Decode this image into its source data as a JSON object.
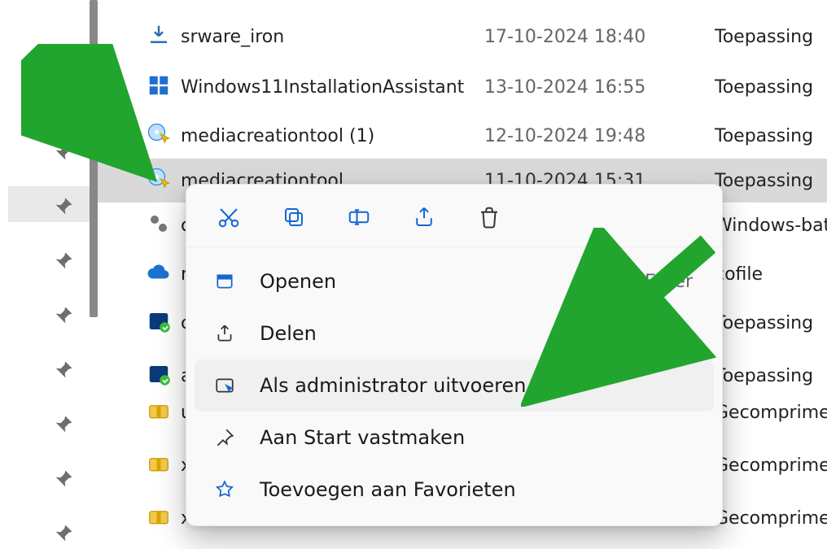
{
  "files": [
    {
      "name": "srware_iron",
      "date": "17-10-2024 18:40",
      "type": "Toepassing",
      "icon": "download"
    },
    {
      "name": "Windows11InstallationAssistant",
      "date": "13-10-2024 16:55",
      "type": "Toepassing",
      "icon": "windows"
    },
    {
      "name": "mediacreationtool (1)",
      "date": "12-10-2024 19:48",
      "type": "Toepassing",
      "icon": "shield-dvd"
    },
    {
      "name": "mediacreationtool",
      "date": "11-10-2024 15:31",
      "type": "Toepassing",
      "icon": "shield-dvd",
      "selected": true
    },
    {
      "name": "c",
      "date": "",
      "type": "Windows-bat",
      "icon": "gear"
    },
    {
      "name": "r",
      "date": "",
      "type": "cofile",
      "icon": "cloud"
    },
    {
      "name": "c",
      "date": "",
      "type": "Toepassing",
      "icon": "iobit"
    },
    {
      "name": "a",
      "date": "",
      "type": "Toepassing",
      "icon": "iobit"
    },
    {
      "name": "u",
      "date": "",
      "type": "Gecomprime",
      "icon": "zip"
    },
    {
      "name": "x",
      "date": "",
      "type": "Gecomprime",
      "icon": "zip"
    },
    {
      "name": "x",
      "date": "",
      "type": "Gecomprime",
      "icon": "zip"
    }
  ],
  "context_menu": {
    "toolbar": {
      "cut": "Cut",
      "copy": "Copy",
      "rename": "Rename",
      "share": "Share",
      "delete": "Delete"
    },
    "items": [
      {
        "icon": "open",
        "label": "Openen",
        "shortcut": "Enter"
      },
      {
        "icon": "share",
        "label": "Delen",
        "shortcut": ""
      },
      {
        "icon": "admin",
        "label": "Als administrator uitvoeren",
        "shortcut": "",
        "hover": true
      },
      {
        "icon": "pin",
        "label": "Aan Start vastmaken",
        "shortcut": ""
      },
      {
        "icon": "star",
        "label": "Toevoegen aan Favorieten",
        "shortcut": ""
      }
    ]
  }
}
